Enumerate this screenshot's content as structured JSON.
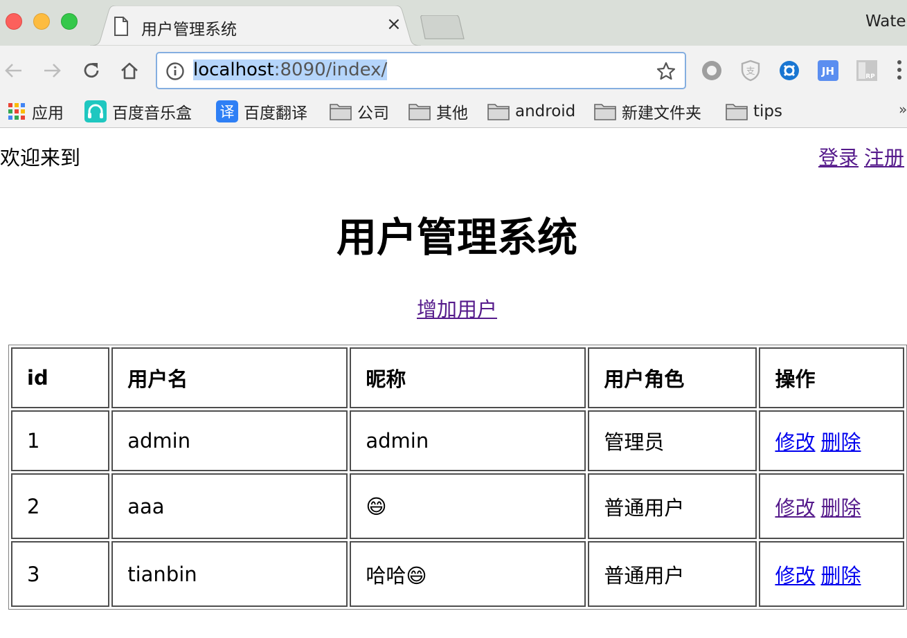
{
  "browser": {
    "tab_title": "用户管理系统",
    "tab_close": "×",
    "profile_name": "Water",
    "url_host": "localhost",
    "url_rest": ":8090/index/",
    "bookmarks": [
      {
        "label": "应用",
        "icon": "apps-grid-icon"
      },
      {
        "label": "百度音乐盒",
        "icon": "baidu-music-icon"
      },
      {
        "label": "百度翻译",
        "icon": "baidu-translate-icon",
        "glyph": "译"
      },
      {
        "label": "公司",
        "icon": "folder-icon"
      },
      {
        "label": "其他",
        "icon": "folder-icon"
      },
      {
        "label": "android",
        "icon": "folder-icon"
      },
      {
        "label": "新建文件夹",
        "icon": "folder-icon"
      },
      {
        "label": "tips",
        "icon": "folder-icon"
      }
    ],
    "bookmarks_more": "»",
    "extensions": [
      "record-icon",
      "shield-extension-icon",
      "blue-extension-icon",
      "jh-extension-icon",
      "rp-extension-icon"
    ],
    "ext_jh_label": "JH",
    "ext_rp_label": "RP",
    "ext_shield_label": "支"
  },
  "page": {
    "welcome": "欢迎来到",
    "login": "登录",
    "register": "注册",
    "title": "用户管理系统",
    "add_user": "增加用户",
    "table": {
      "headers": [
        "id",
        "用户名",
        "昵称",
        "用户角色",
        "操作"
      ],
      "rows": [
        {
          "id": "1",
          "username": "admin",
          "nickname": "admin",
          "role": "管理员",
          "edit": "修改",
          "delete": "删除"
        },
        {
          "id": "2",
          "username": "aaa",
          "nickname": "😄",
          "role": "普通用户",
          "edit": "修改",
          "delete": "删除"
        },
        {
          "id": "3",
          "username": "tianbin",
          "nickname": "哈哈😄",
          "role": "普通用户",
          "edit": "修改",
          "delete": "删除"
        }
      ]
    }
  },
  "colors": {
    "link_unvisited": "#0000ee",
    "link_visited": "#551a8b",
    "url_selection": "#b5d5fb"
  }
}
